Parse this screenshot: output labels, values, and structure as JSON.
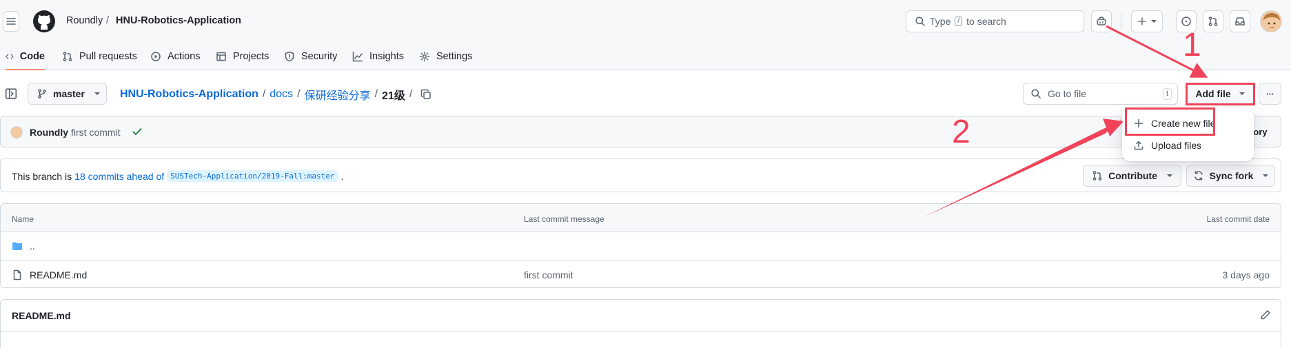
{
  "header": {
    "owner": "Roundly",
    "separator": "/",
    "repo": "HNU-Robotics-Application",
    "search": {
      "prefix": "Type",
      "key": "/",
      "suffix": "to search"
    },
    "plus": "+"
  },
  "repo_nav": {
    "tabs": [
      {
        "label": "Code"
      },
      {
        "label": "Pull requests"
      },
      {
        "label": "Actions"
      },
      {
        "label": "Projects"
      },
      {
        "label": "Security"
      },
      {
        "label": "Insights"
      },
      {
        "label": "Settings"
      }
    ]
  },
  "toolbar": {
    "branch": "master",
    "breadcrumb": [
      {
        "label": "HNU-Robotics-Application"
      },
      {
        "label": "docs"
      },
      {
        "label": "保研经验分享"
      },
      {
        "label": "21级"
      }
    ],
    "slash": "/",
    "goto_placeholder": "Go to file",
    "goto_key": "t",
    "add_file": "Add file",
    "more": "···"
  },
  "commit": {
    "author": "Roundly",
    "message": "first commit",
    "history": "tory"
  },
  "dropdown": {
    "items": [
      {
        "label": "Create new file"
      },
      {
        "label": "Upload files"
      }
    ]
  },
  "branch_info": {
    "prefix": "This branch is",
    "ahead": "18 commits ahead of",
    "upstream": "SUSTech-Application/2019-Fall:master",
    "suffix": ".",
    "contribute": "Contribute",
    "sync": "Sync fork"
  },
  "files": {
    "headers": {
      "name": "Name",
      "message": "Last commit message",
      "date": "Last commit date"
    },
    "rows": [
      {
        "name": "..",
        "message": "",
        "date": ""
      },
      {
        "name": "README.md",
        "message": "first commit",
        "date": "3 days ago"
      }
    ]
  },
  "readme": {
    "title": "README.md"
  },
  "annotations": {
    "step1": "1",
    "step2": "2",
    "color": "#f0445a"
  },
  "colors": {
    "accent": "#0969da",
    "success": "#1a7f37",
    "highlight": "#f0445a",
    "folder": "#54aeff"
  }
}
